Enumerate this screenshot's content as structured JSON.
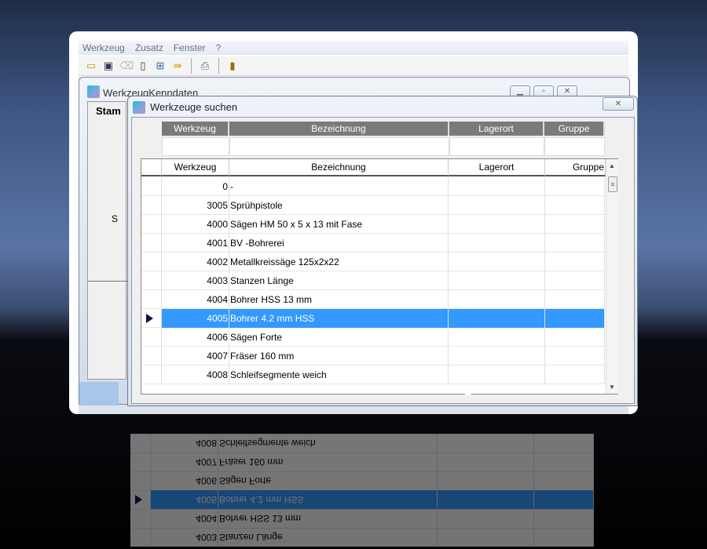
{
  "menu": [
    "Werkzeug",
    "Zusatz",
    "Fenster",
    "?"
  ],
  "toolbar_icons": [
    "new-icon",
    "save-icon",
    "erase-icon",
    "page-icon",
    "grid-icon",
    "transfer-icon",
    "print-icon",
    "exit-door-icon"
  ],
  "main_window": {
    "title": "WerkzeugKenndaten",
    "tab": "Stam",
    "label": "S"
  },
  "dialog": {
    "title": "Werkzeuge suchen",
    "close": "✕"
  },
  "filter_headers": [
    "Werkzeug",
    "Bezeichnung",
    "Lagerort",
    "Gruppe"
  ],
  "grid": {
    "headers": [
      "Werkzeug",
      "Bezeichnung",
      "Lagerort",
      "Gruppe"
    ],
    "rows": [
      {
        "num": "0",
        "bez": "-"
      },
      {
        "num": "3005",
        "bez": "Sprühpistole"
      },
      {
        "num": "4000",
        "bez": "Sägen HM 50 x 5 x 13 mit Fase"
      },
      {
        "num": "4001",
        "bez": "BV -Bohrerei"
      },
      {
        "num": "4002",
        "bez": "Metallkreissäge 125x2x22"
      },
      {
        "num": "4003",
        "bez": "Stanzen Länge"
      },
      {
        "num": "4004",
        "bez": "Bohrer HSS 13 mm"
      },
      {
        "num": "4005",
        "bez": "Bohrer 4.2 mm HSS",
        "selected": true
      },
      {
        "num": "4006",
        "bez": "Sägen Forte"
      },
      {
        "num": "4007",
        "bez": "Fräser 160 mm"
      },
      {
        "num": "4008",
        "bez": "Schleifsegmente weich"
      }
    ]
  },
  "colors": {
    "selection": "#3399ff",
    "header": "#7a7a7a"
  }
}
